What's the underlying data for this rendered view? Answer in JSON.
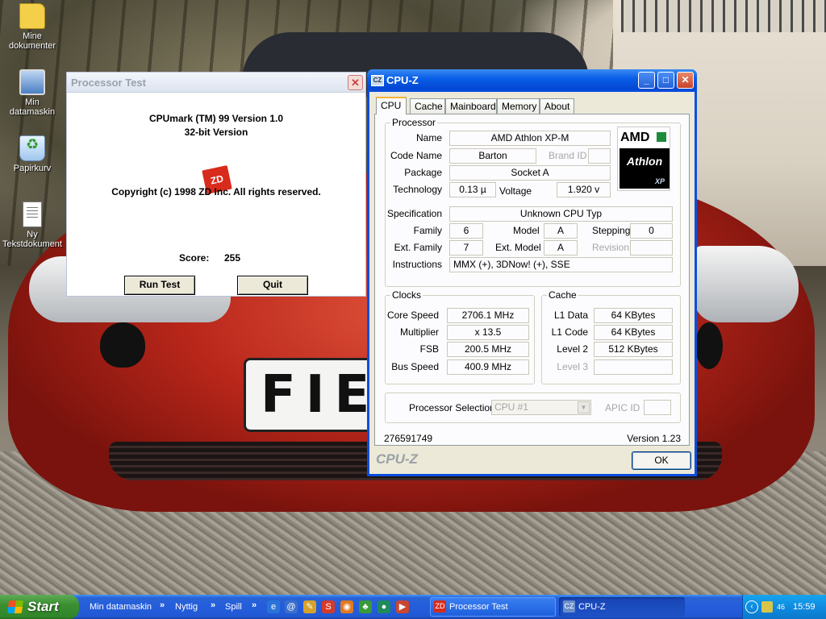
{
  "desktop": {
    "icons": [
      {
        "label": "Mine dokumenter",
        "icon": "folder-icon"
      },
      {
        "label": "Min datamaskin",
        "icon": "computer-icon"
      },
      {
        "label": "Papirkurv",
        "icon": "recycle-bin-icon"
      },
      {
        "label": "Ny Tekstdokument",
        "icon": "text-document-icon"
      }
    ],
    "wallpaper_plate_text": "FIE"
  },
  "processor_test": {
    "title": "Processor Test",
    "close_glyph": "✕",
    "line1": "CPUmark (TM) 99 Version 1.0",
    "line2": "32-bit Version",
    "logo_text": "ZD",
    "copyright": "Copyright (c) 1998 ZD Inc. All rights reserved.",
    "score_label": "Score:",
    "score_value": "255",
    "run_button": "Run Test",
    "quit_button": "Quit"
  },
  "cpuz": {
    "title": "CPU-Z",
    "title_icon_text": "CZ",
    "min_glyph": "_",
    "max_glyph": "□",
    "close_glyph": "✕",
    "tabs": [
      "CPU",
      "Cache",
      "Mainboard",
      "Memory",
      "About"
    ],
    "active_tab": "CPU",
    "processor": {
      "group_title": "Processor",
      "name_label": "Name",
      "name": "AMD Athlon XP-M",
      "codename_label": "Code Name",
      "codename": "Barton",
      "brandid_label": "Brand ID",
      "brandid": "",
      "package_label": "Package",
      "package": "Socket A",
      "technology_label": "Technology",
      "technology": "0.13 µ",
      "voltage_label": "Voltage",
      "voltage": "1.920 v",
      "specification_label": "Specification",
      "specification": "Unknown CPU Typ",
      "family_label": "Family",
      "family": "6",
      "model_label": "Model",
      "model": "A",
      "stepping_label": "Stepping",
      "stepping": "0",
      "ext_family_label": "Ext. Family",
      "ext_family": "7",
      "ext_model_label": "Ext. Model",
      "ext_model": "A",
      "revision_label": "Revision",
      "revision": "",
      "instructions_label": "Instructions",
      "instructions": "MMX (+), 3DNow! (+), SSE",
      "logo": {
        "brand": "AMD",
        "line": "Athlon",
        "suffix": "XP",
        "arrow_color": "#1b8d3a"
      }
    },
    "clocks": {
      "group_title": "Clocks",
      "core_speed_label": "Core Speed",
      "core_speed": "2706.1 MHz",
      "multiplier_label": "Multiplier",
      "multiplier": "x 13.5",
      "fsb_label": "FSB",
      "fsb": "200.5 MHz",
      "bus_speed_label": "Bus Speed",
      "bus_speed": "400.9 MHz"
    },
    "cache": {
      "group_title": "Cache",
      "l1_data_label": "L1 Data",
      "l1_data": "64 KBytes",
      "l1_code_label": "L1 Code",
      "l1_code": "64 KBytes",
      "level2_label": "Level 2",
      "level2": "512 KBytes",
      "level3_label": "Level 3",
      "level3": ""
    },
    "selection": {
      "label": "Processor Selection",
      "value": "CPU #1",
      "apic_label": "APIC ID",
      "apic_value": ""
    },
    "footer_id": "276591749",
    "version": "Version 1.23",
    "brand": "CPU-Z",
    "ok_button": "OK"
  },
  "taskbar": {
    "start_label": "Start",
    "toolbars": [
      "Min datamaskin",
      "Nyttig",
      "Spill"
    ],
    "chevron": "»",
    "quick_launch": [
      {
        "icon": "internet-explorer-icon",
        "glyph": "e",
        "color": "#2a73d8"
      },
      {
        "icon": "outlook-express-icon",
        "glyph": "@",
        "color": "#3b6fcc"
      },
      {
        "icon": "edit-tool-icon",
        "glyph": "✎",
        "color": "#d8a22a"
      },
      {
        "icon": "skype-icon",
        "glyph": "S",
        "color": "#d63a2a"
      },
      {
        "icon": "firefox-icon",
        "glyph": "◉",
        "color": "#e07a24"
      },
      {
        "icon": "messenger-icon",
        "glyph": "♣",
        "color": "#3a9a3a"
      },
      {
        "icon": "globe-icon",
        "glyph": "●",
        "color": "#1f8a5a"
      },
      {
        "icon": "media-tool-icon",
        "glyph": "▶",
        "color": "#c94630"
      }
    ],
    "tasks": [
      {
        "label": "Processor Test",
        "icon": "zd-app-icon",
        "glyph": "ZD",
        "active": false
      },
      {
        "label": "CPU-Z",
        "icon": "cpuz-app-icon",
        "glyph": "CZ",
        "active": true
      }
    ],
    "tray": {
      "show_hidden_glyph": "‹",
      "network_badge": "46",
      "clock": "15:59"
    }
  }
}
